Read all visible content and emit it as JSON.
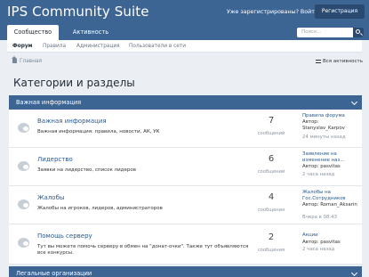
{
  "header": {
    "logo": "IPS Community Suite",
    "user_link": "Уже зарегистрированы? Войти",
    "register_label": "Регистрация"
  },
  "tabs": [
    {
      "label": "Сообщество",
      "active": true
    },
    {
      "label": "Активность",
      "active": false
    }
  ],
  "search": {
    "placeholder": "Поиск..."
  },
  "subnav": [
    {
      "label": "Форум"
    },
    {
      "label": "Правила"
    },
    {
      "label": "Администрация"
    },
    {
      "label": "Пользователи в сети"
    }
  ],
  "breadcrumb": {
    "home": "Главная",
    "activity": "Вся активность"
  },
  "page_title": "Категории и разделы",
  "categories": [
    {
      "name": "Важная информация"
    },
    {
      "name": "Легальные организации"
    }
  ],
  "forums": [
    {
      "title": "Важная информация",
      "description": "Важная информация: правила, новости, АК, УК",
      "count": "7",
      "count_label": "сообщений",
      "last_title": "Правила форума",
      "last_author": "Автор: Stanyslav_Karpov",
      "last_time": "24 минуты назад"
    },
    {
      "title": "Лидерство",
      "description": "Заявки на лидерство, список лидеров",
      "count": "6",
      "count_label": "сообщений",
      "last_title": "Заявление на изменение наз...",
      "last_author": "Автор: pasvitas",
      "last_time": "2 часа назад"
    },
    {
      "title": "Жалобы",
      "description": "Жалобы на игроков, лидеров, администраторов",
      "count": "4",
      "count_label": "сообщения",
      "last_title": "Жалобы на Гос.Сотрудников",
      "last_author": "Автор: Roman_Aksarin",
      "last_time": "Вчера в 08:43"
    },
    {
      "title": "Помощь серверу",
      "description": "Тут вы можете помочь серверу в обмен на \"донат-очки\". Также тут объявляются все конкурсы.",
      "description_line1": "Тут вы можете помочь серверу в обмен на \"донат-очки\". Также тут объявляются",
      "description_line2": "все конкурсы.",
      "count": "2",
      "count_label": "сообщения",
      "last_title": "Акции",
      "last_author": "Автор: pasvitas",
      "last_time": "2 часа назад"
    }
  ],
  "colors": {
    "brand": "#3d6594",
    "link": "#2b5a8f",
    "background": "#ebeef2"
  }
}
